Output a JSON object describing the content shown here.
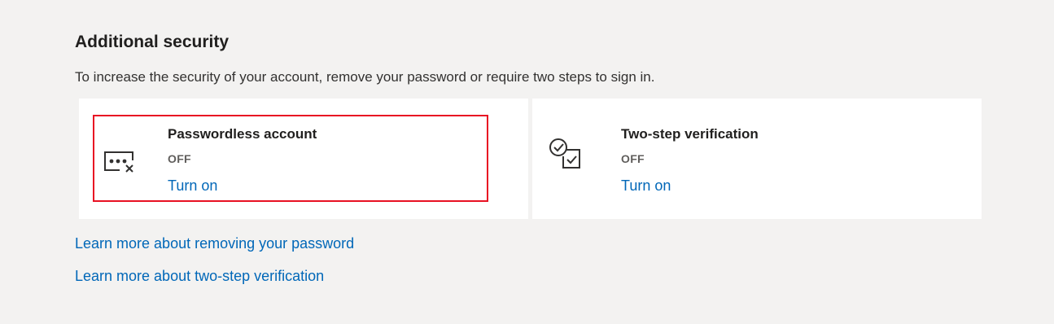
{
  "section": {
    "title": "Additional security",
    "description": "To increase the security of your account, remove your password or require two steps to sign in."
  },
  "cards": [
    {
      "icon": "password-dots-remove-icon",
      "title": "Passwordless account",
      "status": "OFF",
      "action": "Turn on"
    },
    {
      "icon": "two-step-check-icon",
      "title": "Two-step verification",
      "status": "OFF",
      "action": "Turn on"
    }
  ],
  "links": [
    "Learn more about removing your password",
    "Learn more about two-step verification"
  ],
  "colors": {
    "background": "#f3f2f1",
    "card": "#ffffff",
    "link": "#0067b8",
    "highlight_border": "#e81123",
    "text": "#323130"
  }
}
